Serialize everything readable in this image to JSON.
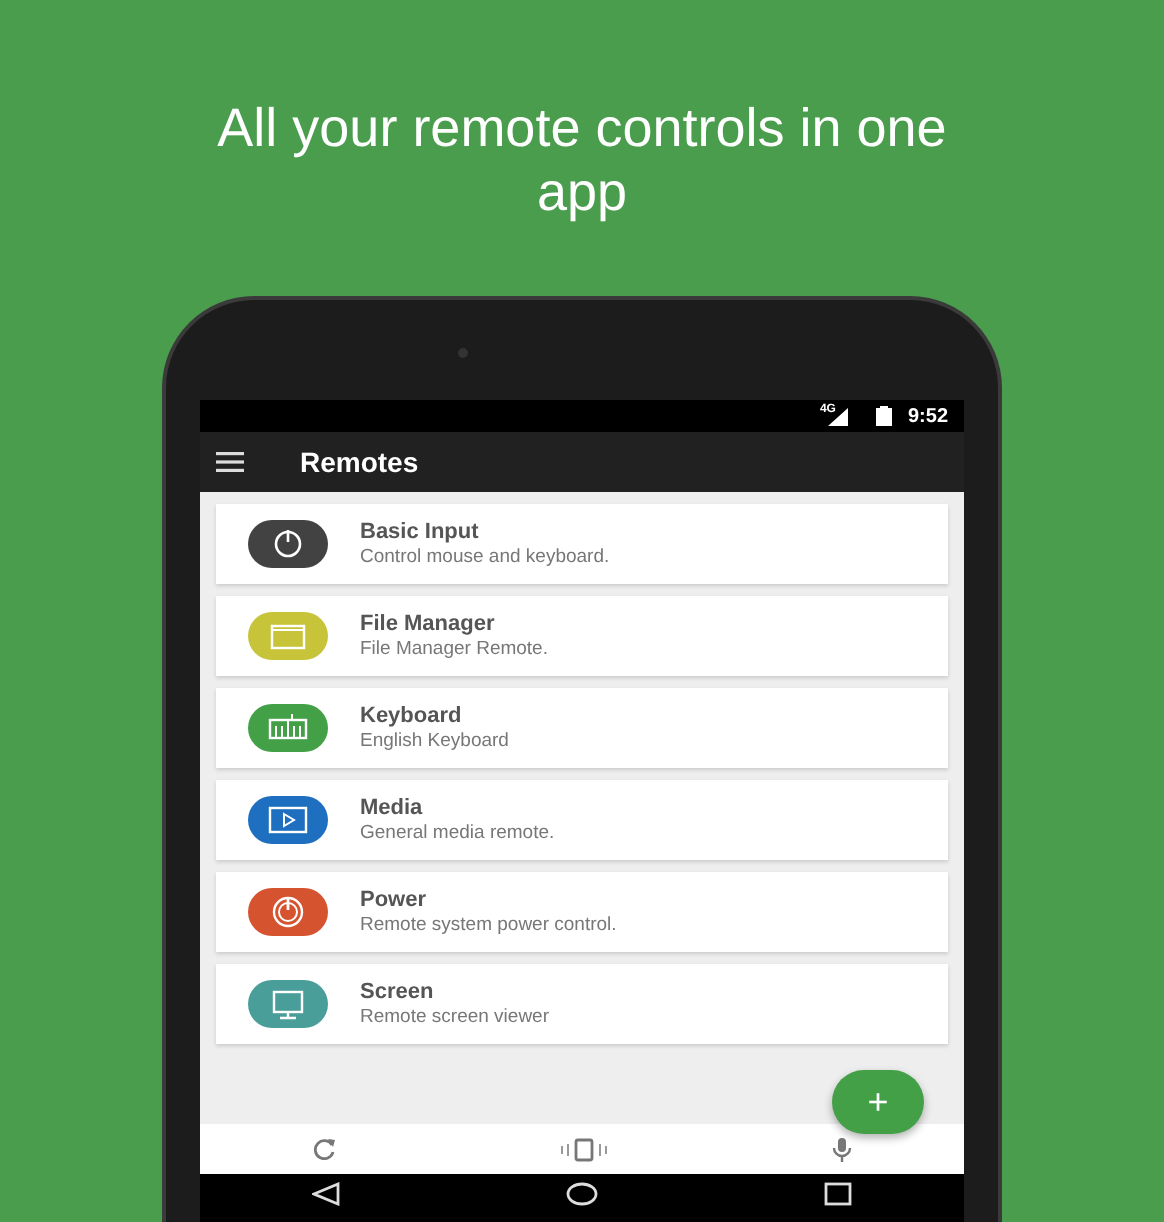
{
  "headline": "All your remote controls in one app",
  "status_bar": {
    "network": "4G",
    "time": "9:52"
  },
  "app_bar": {
    "title": "Remotes"
  },
  "remotes": [
    {
      "kind": "input",
      "title": "Basic Input",
      "subtitle": "Control mouse and keyboard.",
      "color": "#424242"
    },
    {
      "kind": "folder",
      "title": "File Manager",
      "subtitle": "File Manager Remote.",
      "color": "#c8c43a"
    },
    {
      "kind": "keyboard",
      "title": "Keyboard",
      "subtitle": "English Keyboard",
      "color": "#43a047"
    },
    {
      "kind": "media",
      "title": "Media",
      "subtitle": "General media remote.",
      "color": "#1e6fc0"
    },
    {
      "kind": "power",
      "title": "Power",
      "subtitle": "Remote system power control.",
      "color": "#d65330"
    },
    {
      "kind": "screen",
      "title": "Screen",
      "subtitle": "Remote screen viewer",
      "color": "#4a9e9a"
    }
  ],
  "fab": {
    "label": "+"
  }
}
